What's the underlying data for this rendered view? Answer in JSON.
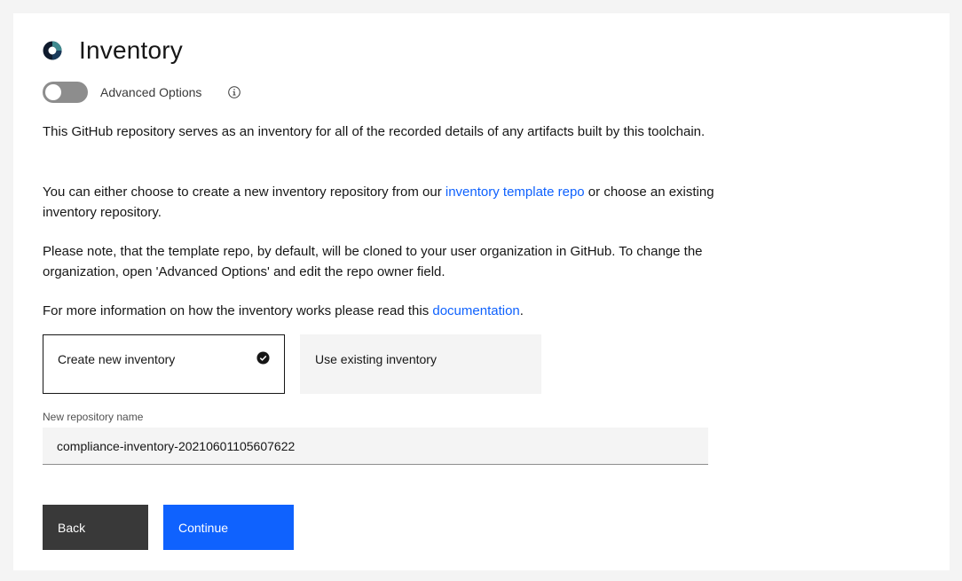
{
  "header": {
    "title": "Inventory",
    "logo_icon": "ring-logo-icon"
  },
  "advanced_options": {
    "label": "Advanced Options",
    "enabled": false,
    "info_icon": "info-icon"
  },
  "description": {
    "p1": "This GitHub repository serves as an inventory for all of the recorded details of any artifacts built by this toolchain.",
    "p2_before": "You can either choose to create a new inventory repository from our ",
    "p2_link": "inventory template repo",
    "p2_after": " or choose an existing inventory repository.",
    "p3": "Please note, that the template repo, by default, will be cloned to your user organization in GitHub. To change the organization, open 'Advanced Options' and edit the repo owner field.",
    "p4_before": "For more information on how the inventory works please read this ",
    "p4_link": "documentation",
    "p4_after": "."
  },
  "tiles": {
    "create_new": {
      "label": "Create new inventory",
      "selected": true
    },
    "use_existing": {
      "label": "Use existing inventory",
      "selected": false
    }
  },
  "repo_name_field": {
    "label": "New repository name",
    "value": "compliance-inventory-20210601105607622"
  },
  "buttons": {
    "back": "Back",
    "continue": "Continue"
  },
  "colors": {
    "accent": "#0f62fe",
    "dark_button": "#393939",
    "background": "#f4f4f4"
  }
}
